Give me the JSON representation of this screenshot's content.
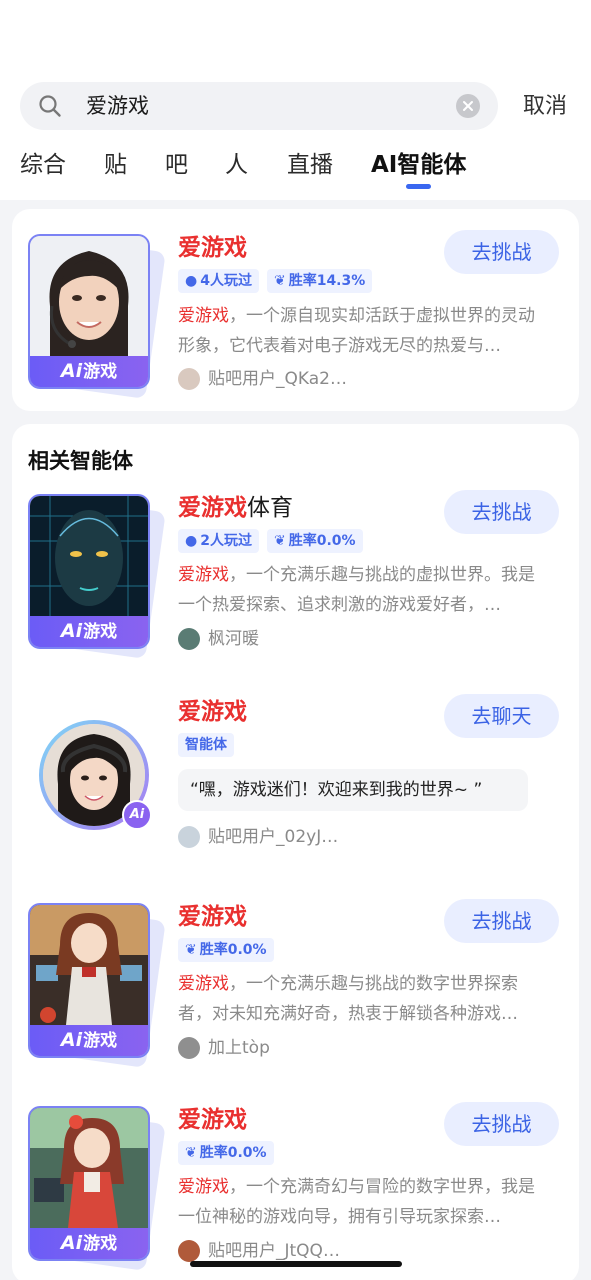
{
  "search": {
    "query": "爱游戏",
    "cancel": "取消"
  },
  "tabs": [
    "综合",
    "贴",
    "吧",
    "人",
    "直播",
    "AI智能体"
  ],
  "active_tab": 5,
  "accent": "#3a67f0",
  "highlight": "#e9302f",
  "top_result": {
    "name": "爱游戏",
    "tags": [
      "4人玩过",
      "胜率14.3%"
    ],
    "desc_hl": "爱游戏",
    "desc": "，一个源自现实却活跃于虚拟世界的灵动形象，它代表着对电子游戏无尽的热爱与…",
    "author": "贴吧用户_QKa2…",
    "cta": "去挑战",
    "badge": "游戏",
    "badge_ai": "Ai"
  },
  "related_title": "相关智能体",
  "related": [
    {
      "name_hl": "爱游戏",
      "name_rest": "体育",
      "tags": [
        "2人玩过",
        "胜率0.0%"
      ],
      "desc_hl": "爱游戏",
      "desc": "，一个充满乐趣与挑战的虚拟世界。我是一个热爱探索、追求刺激的游戏爱好者，…",
      "author": "枫河暖",
      "cta": "去挑战",
      "badge": "游戏",
      "badge_ai": "Ai"
    },
    {
      "name_hl": "爱游戏",
      "tag": "智能体",
      "quote": "“嘿，游戏迷们！欢迎来到我的世界~ ”",
      "author": "贴吧用户_02yJ…",
      "cta": "去聊天",
      "badge_ai": "Ai"
    },
    {
      "name_hl": "爱游戏",
      "tags": [
        "胜率0.0%"
      ],
      "desc_hl": "爱游戏",
      "desc": "，一个充满乐趣与挑战的数字世界探索者，对未知充满好奇，热衷于解锁各种游戏…",
      "author": "加上tòp",
      "cta": "去挑战",
      "badge": "游戏",
      "badge_ai": "Ai"
    },
    {
      "name_hl": "爱游戏",
      "tags": [
        "胜率0.0%"
      ],
      "desc_hl": "爱游戏",
      "desc": "，一个充满奇幻与冒险的数字世界，我是一位神秘的游戏向导，拥有引导玩家探索…",
      "author": "贴吧用户_JtQQ…",
      "cta": "去挑战",
      "badge": "游戏",
      "badge_ai": "Ai"
    }
  ]
}
